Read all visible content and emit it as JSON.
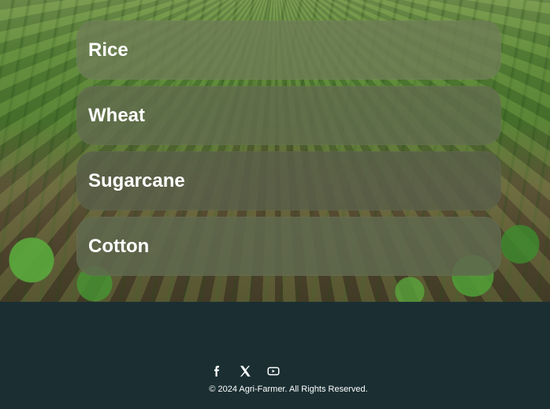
{
  "crops": [
    {
      "label": "Rice"
    },
    {
      "label": "Wheat"
    },
    {
      "label": "Sugarcane"
    },
    {
      "label": "Cotton"
    }
  ],
  "footer": {
    "social_icons": [
      "facebook-icon",
      "x-icon",
      "youtube-icon"
    ],
    "copyright": "© 2024 Agri-Farmer. All Rights Reserved."
  },
  "colors": {
    "footer_bg": "#1b2f33",
    "card_text": "#ffffff"
  }
}
